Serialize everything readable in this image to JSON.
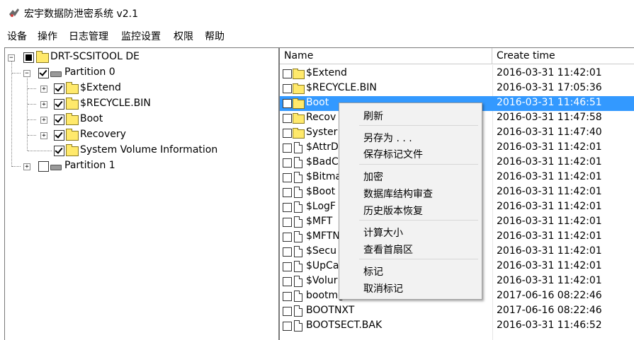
{
  "window": {
    "title": "宏宇数据防泄密系统 v2.1",
    "icon": "app-logo-icon"
  },
  "menubar": [
    "设备",
    "操作",
    "日志管理",
    "监控设置",
    "权限",
    "帮助"
  ],
  "tree": {
    "root": {
      "label": "DRT-SCSITOOL DE",
      "expander": "minus",
      "check": "partial"
    },
    "partition0": {
      "label": "Partition 0",
      "expander": "minus",
      "check": "checked"
    },
    "children": [
      {
        "label": "$Extend",
        "expander": "plus",
        "check": "checked"
      },
      {
        "label": "$RECYCLE.BIN",
        "expander": "plus",
        "check": "checked"
      },
      {
        "label": "Boot",
        "expander": "plus",
        "check": "checked"
      },
      {
        "label": "Recovery",
        "expander": "plus",
        "check": "checked"
      },
      {
        "label": "System Volume Information",
        "expander": "none",
        "check": "checked"
      }
    ],
    "partition1": {
      "label": "Partition 1",
      "expander": "plus",
      "check": "unchecked"
    }
  },
  "list": {
    "columns": [
      "Name",
      "Create time"
    ],
    "rows": [
      {
        "name": "$Extend",
        "time": "2016-03-31  11:42:01",
        "type": "folder",
        "selected": false
      },
      {
        "name": "$RECYCLE.BIN",
        "time": "2016-03-31  17:05:36",
        "type": "folder",
        "selected": false
      },
      {
        "name": "Boot",
        "time": "2016-03-31  11:46:51",
        "type": "folder",
        "selected": true
      },
      {
        "name": "Recov",
        "time": "2016-03-31  11:47:58",
        "type": "folder",
        "selected": false
      },
      {
        "name": "Syster",
        "time": "2016-03-31  11:47:40",
        "type": "folder",
        "selected": false
      },
      {
        "name": "$AttrD",
        "time": "2016-03-31  11:42:01",
        "type": "file",
        "selected": false
      },
      {
        "name": "$BadC",
        "time": "2016-03-31  11:42:01",
        "type": "file",
        "selected": false
      },
      {
        "name": "$Bitma",
        "time": "2016-03-31  11:42:01",
        "type": "file",
        "selected": false
      },
      {
        "name": "$Boot",
        "time": "2016-03-31  11:42:01",
        "type": "file",
        "selected": false
      },
      {
        "name": "$LogF",
        "time": "2016-03-31  11:42:01",
        "type": "file",
        "selected": false
      },
      {
        "name": "$MFT",
        "time": "2016-03-31  11:42:01",
        "type": "file",
        "selected": false
      },
      {
        "name": "$MFTN",
        "time": "2016-03-31  11:42:01",
        "type": "file",
        "selected": false
      },
      {
        "name": "$Secu",
        "time": "2016-03-31  11:42:01",
        "type": "file",
        "selected": false
      },
      {
        "name": "$UpCa",
        "time": "2016-03-31  11:42:01",
        "type": "file",
        "selected": false
      },
      {
        "name": "$Volur",
        "time": "2016-03-31  11:42:01",
        "type": "file",
        "selected": false
      },
      {
        "name": "bootmgr",
        "time": "2017-06-16  08:22:46",
        "type": "file",
        "selected": false
      },
      {
        "name": "BOOTNXT",
        "time": "2017-06-16  08:22:46",
        "type": "file",
        "selected": false
      },
      {
        "name": "BOOTSECT.BAK",
        "time": "2016-03-31  11:46:52",
        "type": "file",
        "selected": false
      }
    ]
  },
  "context_menu": {
    "groups": [
      [
        "刷新"
      ],
      [
        "另存为 . . .",
        "保存标记文件"
      ],
      [
        "加密",
        "数据库结构审查",
        "历史版本恢复"
      ],
      [
        "计算大小",
        "查看首扇区"
      ],
      [
        "标记",
        "取消标记"
      ]
    ]
  },
  "colors": {
    "selection": "#3399ff",
    "folder": "#ffe96b",
    "menu_bg": "#f2f2f2"
  }
}
